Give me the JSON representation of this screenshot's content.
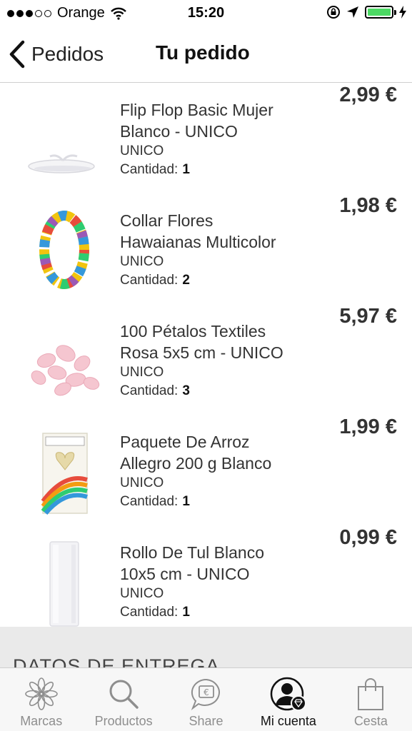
{
  "status_bar": {
    "carrier": "Orange",
    "time": "15:20"
  },
  "nav": {
    "back_label": "Pedidos",
    "title": "Tu pedido"
  },
  "items": [
    {
      "name": "Flip Flop Basic Mujer Blanco - UNICO",
      "variant": "UNICO",
      "qty_label": "Cantidad:",
      "qty": "1",
      "price": "2,99 €",
      "image": "flip-flop-image"
    },
    {
      "name": "Collar Flores Hawaianas  Multicolor",
      "variant": "UNICO",
      "qty_label": "Cantidad:",
      "qty": "2",
      "price": "1,98 €",
      "image": "flower-lei-image"
    },
    {
      "name": "100 Pétalos Textiles Rosa  5x5 cm - UNICO",
      "variant": "UNICO",
      "qty_label": "Cantidad:",
      "qty": "3",
      "price": "5,97 €",
      "image": "rose-petals-image"
    },
    {
      "name": "Paquete De Arroz Allegro 200 g  Blanco",
      "variant": "UNICO",
      "qty_label": "Cantidad:",
      "qty": "1",
      "price": "1,99 €",
      "image": "rice-package-image"
    },
    {
      "name": "Rollo De Tul Blanco 10x5 cm - UNICO",
      "variant": "UNICO",
      "qty_label": "Cantidad:",
      "qty": "1",
      "price": "0,99 €",
      "image": "tulle-roll-image"
    }
  ],
  "delivery_section": {
    "title": "DATOS DE ENTREGA"
  },
  "tabs": [
    {
      "label": "Marcas",
      "icon": "flower-icon",
      "active": false
    },
    {
      "label": "Productos",
      "icon": "search-icon",
      "active": false
    },
    {
      "label": "Share",
      "icon": "euro-chat-icon",
      "active": false
    },
    {
      "label": "Mi cuenta",
      "icon": "account-icon",
      "active": true
    },
    {
      "label": "Cesta",
      "icon": "bag-icon",
      "active": false
    }
  ],
  "colors": {
    "battery": "#4cd964",
    "inactive_tab": "#8e8e8e",
    "section_band": "#eaeaea"
  }
}
